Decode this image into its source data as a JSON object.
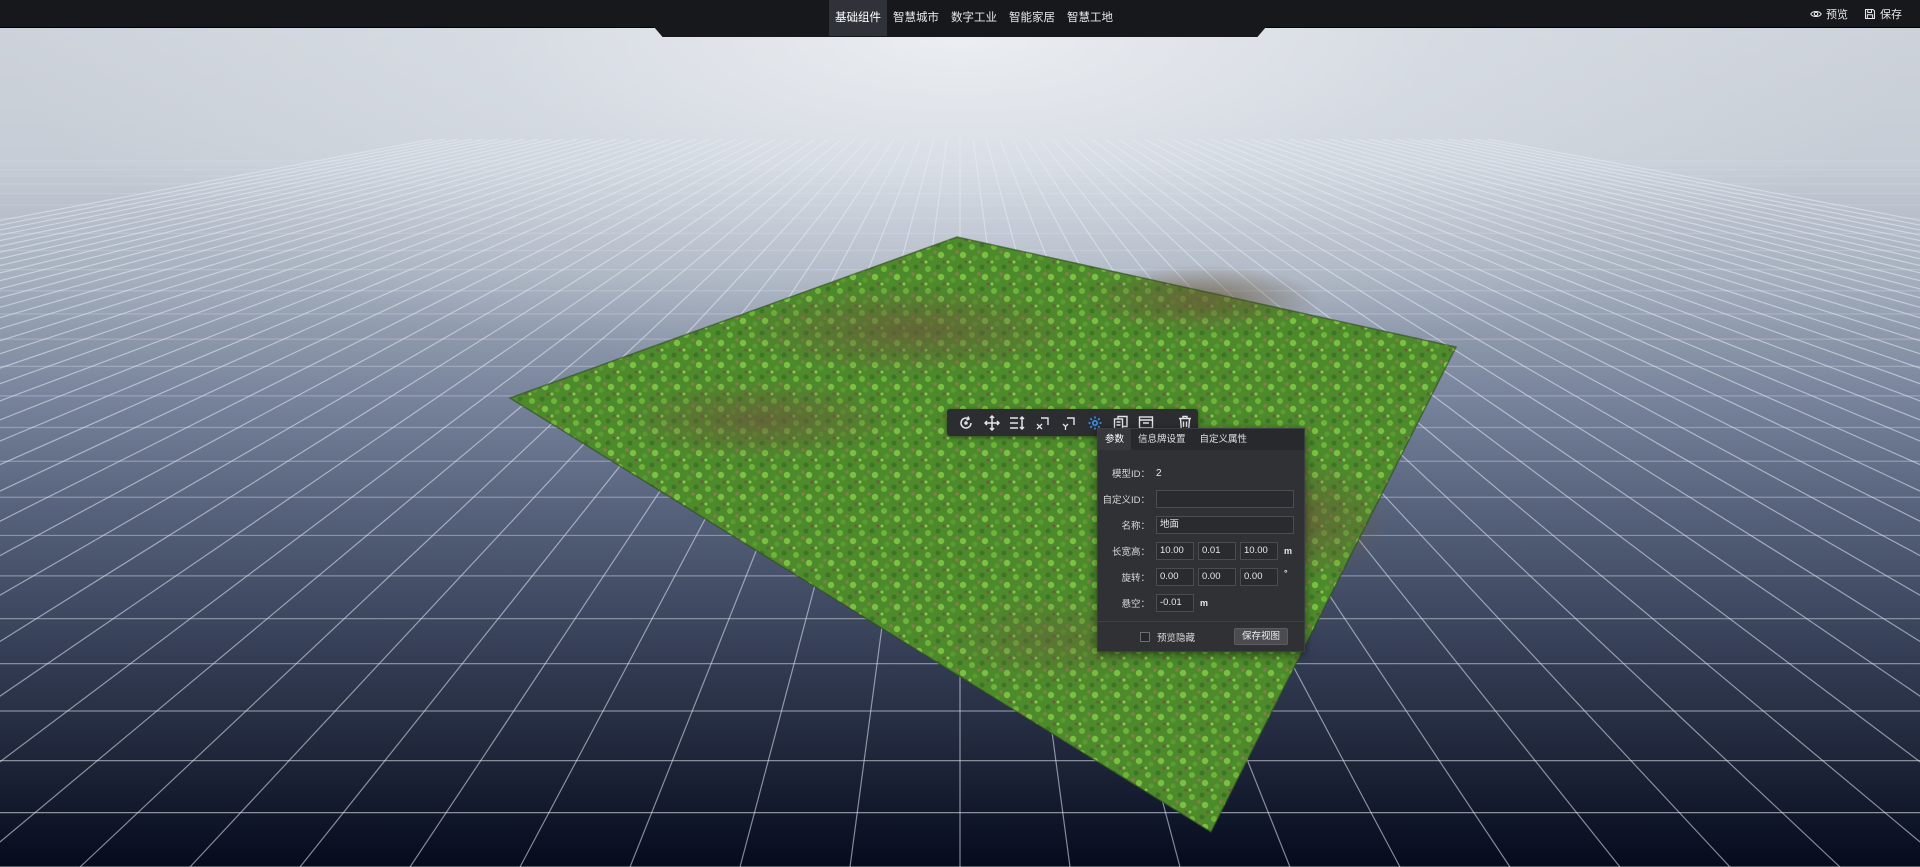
{
  "nav": {
    "tabs": [
      {
        "label": "基础组件",
        "active": true
      },
      {
        "label": "智慧城市",
        "active": false
      },
      {
        "label": "数字工业",
        "active": false
      },
      {
        "label": "智能家居",
        "active": false
      },
      {
        "label": "智慧工地",
        "active": false
      }
    ],
    "actions": {
      "preview": {
        "label": "预览",
        "icon": "eye-icon"
      },
      "save": {
        "label": "保存",
        "icon": "save-icon"
      }
    }
  },
  "toolbar": {
    "tools": [
      {
        "name": "rotate-icon",
        "active": false
      },
      {
        "name": "move-icon",
        "active": false
      },
      {
        "name": "height-adjust-icon",
        "active": false
      },
      {
        "name": "scale-x-icon",
        "active": false
      },
      {
        "name": "scale-y-icon",
        "active": false
      },
      {
        "name": "settings-icon",
        "active": true
      },
      {
        "name": "copy-icon",
        "active": false
      },
      {
        "name": "panel-icon",
        "active": false
      },
      {
        "name": "delete-icon",
        "active": false
      }
    ],
    "accent": "#3b9cff"
  },
  "panel": {
    "tabs": [
      {
        "label": "参数",
        "active": true
      },
      {
        "label": "信息牌设置",
        "active": false
      },
      {
        "label": "自定义属性",
        "active": false
      }
    ],
    "model_id": {
      "label": "模型ID：",
      "value": "2"
    },
    "custom_id": {
      "label": "自定义ID：",
      "value": ""
    },
    "name": {
      "label": "名称：",
      "value": "地面"
    },
    "size": {
      "label": "长宽高：",
      "values": [
        "10.00",
        "0.01",
        "10.00"
      ],
      "unit": "m"
    },
    "rotation": {
      "label": "旋转：",
      "values": [
        "0.00",
        "0.00",
        "0.00"
      ],
      "unit": "°"
    },
    "float": {
      "label": "悬空：",
      "value": "-0.01",
      "unit": "m"
    },
    "footer": {
      "hide_in_preview": {
        "label": "预览隐藏",
        "checked": false
      },
      "save_view": "保存视图"
    }
  },
  "scene": {
    "sky_color": "#cfd4db",
    "grid_color": "#e8edf5",
    "ground_color": "#4b8a2a"
  }
}
